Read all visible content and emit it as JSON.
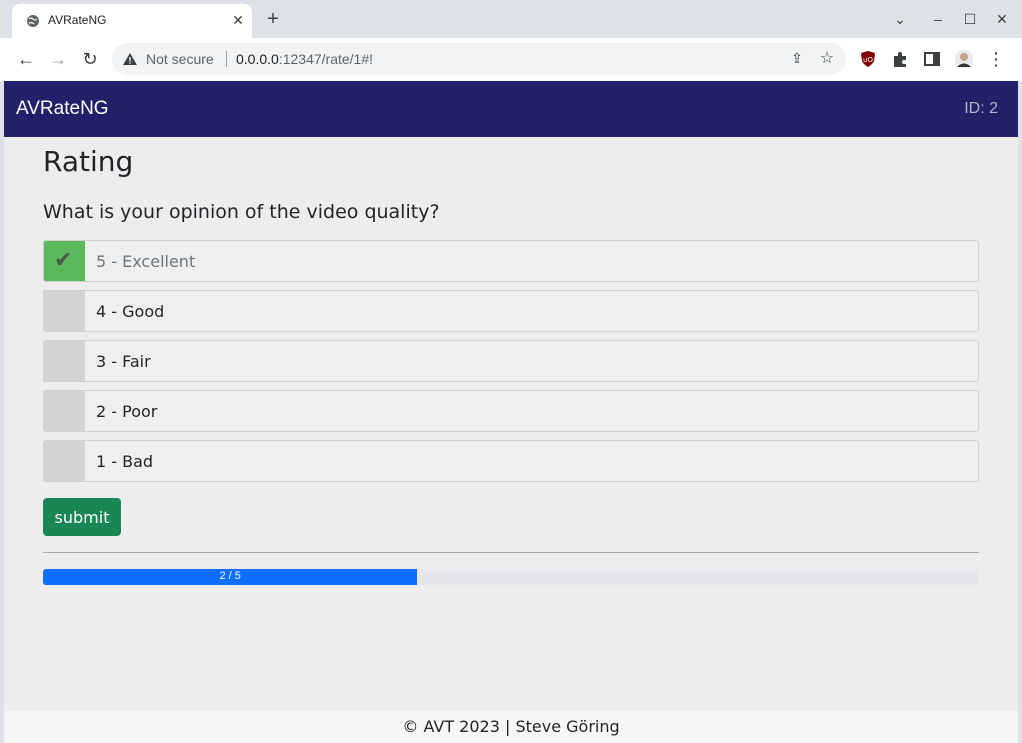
{
  "browser": {
    "tab_title": "AVRateNG",
    "security_label": "Not secure",
    "url_host": "0.0.0.0",
    "url_path": ":12347/rate/1#!"
  },
  "app": {
    "brand": "AVRateNG",
    "user_id": "ID: 2",
    "heading": "Rating",
    "question": "What is your opinion of the video quality?",
    "options": [
      {
        "label": "5 - Excellent",
        "selected": true
      },
      {
        "label": "4 - Good",
        "selected": false
      },
      {
        "label": "3 - Fair",
        "selected": false
      },
      {
        "label": "2 - Poor",
        "selected": false
      },
      {
        "label": "1 - Bad",
        "selected": false
      }
    ],
    "submit_label": "submit",
    "progress": {
      "text": "2 / 5",
      "current": 2,
      "total": 5,
      "fraction": 0.4
    },
    "footer": "© AVT 2023 | Steve Göring"
  },
  "colors": {
    "navbar": "#212068",
    "selected": "#5cb85c",
    "submit": "#198754",
    "progress": "#0d6efd"
  }
}
